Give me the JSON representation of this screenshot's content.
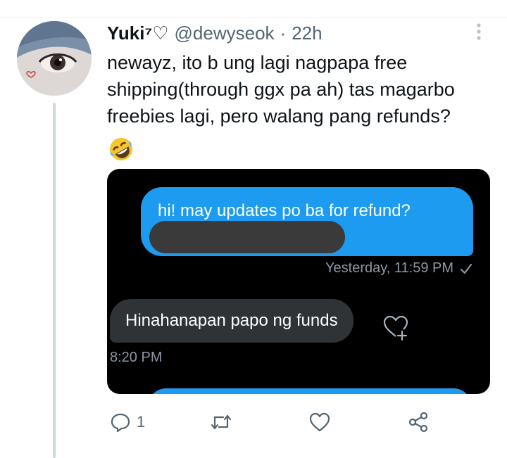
{
  "tweet": {
    "author_name": "Yuki⁷♡",
    "handle": "@dewyseok",
    "separator": "·",
    "time": "22h",
    "text": "newayz, ito b ung lagi nagpapa free shipping(through ggx pa ah) tas magarbo freebies lagi, pero walang pang refunds?",
    "emoji": "rolling-on-floor-laughing",
    "more_icon": "more-vertical-icon"
  },
  "media": {
    "messages": [
      {
        "direction": "sent",
        "text": "hi! may updates po ba for refund?",
        "meta": "Yesterday, 11:59 PM",
        "status_icon": "check-icon"
      },
      {
        "direction": "received",
        "text": "Hinahanapan papo ng funds",
        "meta": "8:20 PM",
        "reaction_icon": "add-reaction-heart-icon"
      }
    ]
  },
  "actions": {
    "reply_count": "1",
    "icons": [
      "reply-icon",
      "retweet-icon",
      "like-icon",
      "share-icon"
    ]
  },
  "colors": {
    "accent": "#1d9bf0",
    "received_bubble": "#2f3336",
    "muted": "#536471"
  }
}
